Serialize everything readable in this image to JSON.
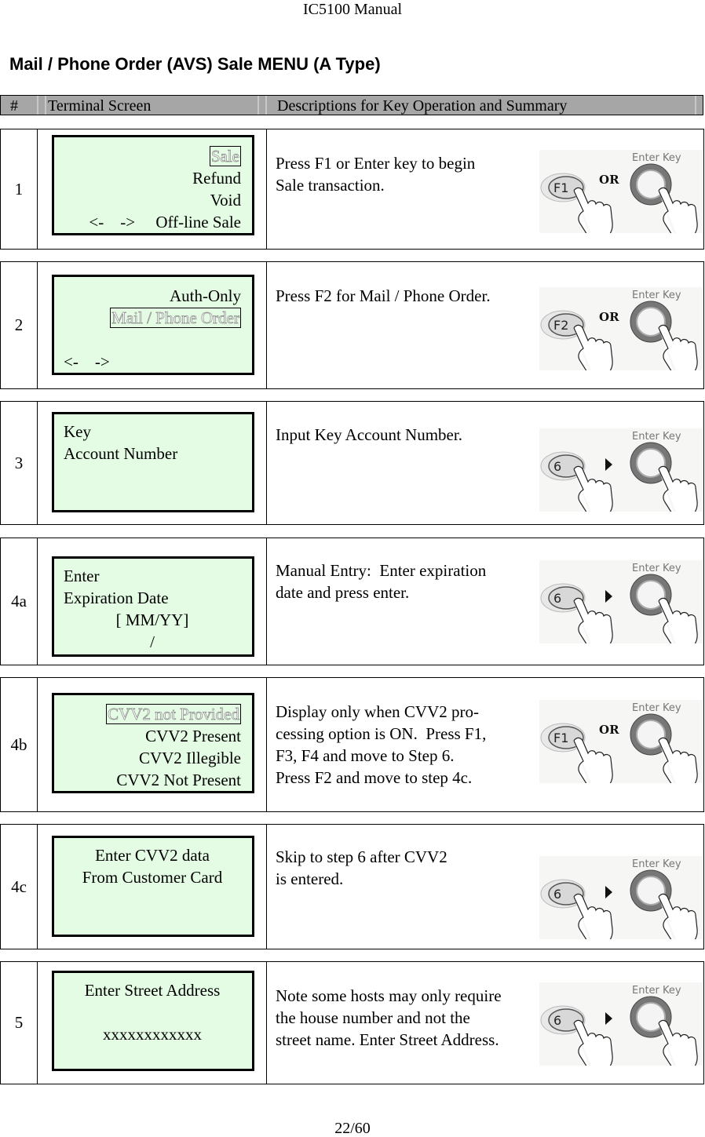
{
  "running_head": "IC5100 Manual",
  "page_title": "Mail / Phone Order (AVS) Sale MENU (A Type)",
  "table_header": {
    "num": "#",
    "screen": "Terminal Screen",
    "desc": "Descriptions for Key Operation and Summary"
  },
  "rows": [
    {
      "num": "1",
      "screen": {
        "lines": [
          "Sale",
          "Refund",
          "Void",
          "<-    ->     Off-line Sale"
        ],
        "highlighted": "Sale"
      },
      "description": "Press F1 or Enter key to begin\nSale transaction.",
      "keys": {
        "first": "F1",
        "connector": "OR",
        "second": "Enter Key"
      }
    },
    {
      "num": "2",
      "screen": {
        "lines": [
          "Auth-Only",
          "Mail / Phone Order",
          "",
          "<-    ->"
        ],
        "highlighted": "Mail / Phone Order"
      },
      "description": "Press F2 for Mail / Phone Order.",
      "keys": {
        "first": "F2",
        "connector": "OR",
        "second": "Enter Key"
      }
    },
    {
      "num": "3",
      "screen": {
        "lines": [
          "Key",
          "Account Number"
        ]
      },
      "description": "Input Key Account Number.",
      "keys": {
        "first": "6",
        "connector": "arrow",
        "second": "Enter Key"
      }
    },
    {
      "num": "4a",
      "screen": {
        "lines": [
          "Enter",
          "Expiration Date",
          "[ MM/YY]",
          "/"
        ]
      },
      "description": "Manual Entry:  Enter expiration\ndate and press enter.",
      "keys": {
        "first": "6",
        "connector": "arrow",
        "second": "Enter Key"
      }
    },
    {
      "num": "4b",
      "screen": {
        "lines": [
          "CVV2 not Provided",
          "CVV2 Present",
          "CVV2 Illegible",
          "CVV2 Not Present"
        ],
        "highlighted": "CVV2 not Provided"
      },
      "description": "Display only when CVV2 pro-\ncessing option is ON.  Press F1,\nF3, F4 and move to Step 6.\nPress F2 and move to step 4c.",
      "keys": {
        "first": "F1",
        "connector": "OR",
        "second": "Enter Key"
      }
    },
    {
      "num": "4c",
      "screen": {
        "lines": [
          "Enter CVV2 data",
          "From Customer Card"
        ]
      },
      "description": "Skip to step 6 after CVV2\nis entered.",
      "keys": {
        "first": "6",
        "connector": "arrow",
        "second": "Enter Key"
      }
    },
    {
      "num": "5",
      "screen": {
        "lines": [
          "Enter Street Address",
          "",
          "xxxxxxxxxxxx"
        ]
      },
      "description": "Note some hosts may only require\nthe house number and not the\nstreet name. Enter Street Address.",
      "keys": {
        "first": "6",
        "connector": "arrow",
        "second": "Enter Key"
      }
    }
  ],
  "page_number": "22/60",
  "colors": {
    "lcd_background": "#e4fce4",
    "header_background": "#a6a6a6"
  }
}
